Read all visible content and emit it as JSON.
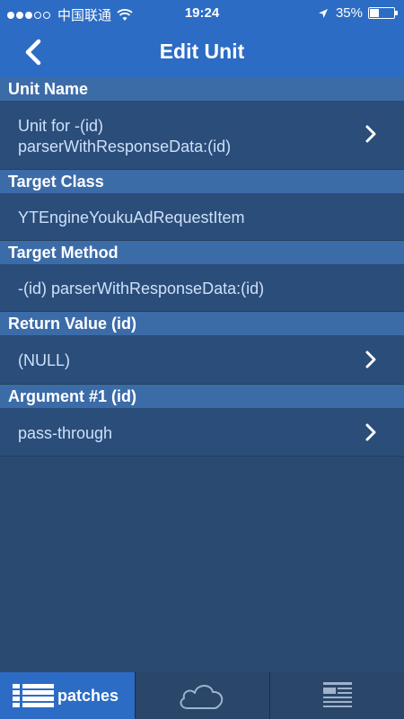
{
  "status_bar": {
    "carrier": "中国联通",
    "time": "19:24",
    "battery": "35%",
    "signal_bars_filled": 3,
    "signal_bars_total": 5
  },
  "nav": {
    "title": "Edit Unit",
    "back_icon": "chevron-left-icon"
  },
  "sections": {
    "unit_name": {
      "header": "Unit Name",
      "line1": "Unit for -(id)",
      "line2": "parserWithResponseData:(id)"
    },
    "target_class": {
      "header": "Target Class",
      "value": "YTEngineYoukuAdRequestItem"
    },
    "target_method": {
      "header": "Target Method",
      "value": "-(id) parserWithResponseData:(id)"
    },
    "return_value": {
      "header": "Return Value (id)",
      "value": "(NULL)"
    },
    "argument1": {
      "header": "Argument #1 (id)",
      "value": "pass-through"
    }
  },
  "tabs": [
    {
      "label": "patches",
      "icon": "list-icon",
      "active": true
    },
    {
      "label": "",
      "icon": "cloud-icon",
      "active": false
    },
    {
      "label": "",
      "icon": "document-icon",
      "active": false
    }
  ],
  "colors": {
    "nav_blue": "#2c6cc4",
    "background": "#2a4a72",
    "section_header": "#3c6ca8",
    "cell_text": "#cde0fa"
  }
}
